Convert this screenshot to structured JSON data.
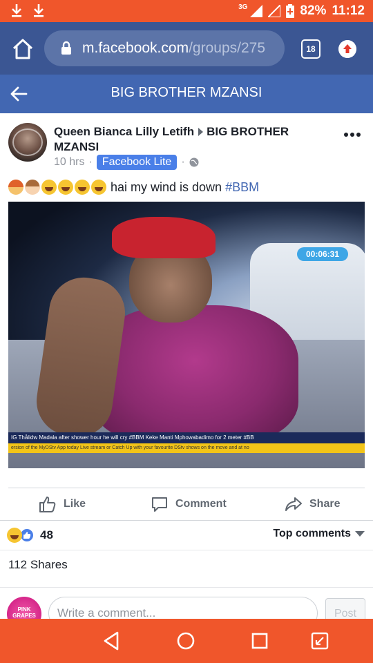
{
  "status_bar": {
    "network": "3G",
    "battery": "82%",
    "time": "11:12"
  },
  "browser": {
    "url_host": "m.facebook.com",
    "url_path": "/groups/275",
    "tab_count": "18"
  },
  "group": {
    "title": "BIG BROTHER MZANSI"
  },
  "post": {
    "author": "Queen Bianca Lilly Letifh",
    "group_name": "BIG BROTHER MZANSI",
    "time": "10 hrs",
    "app_badge": "Facebook Lite",
    "text": "hai my wind is down",
    "hashtag": "#BBM",
    "photo": {
      "timer": "00:06:31",
      "ticker_top": "IG Thålidw  Madala after shower hour he will cry #BBM   Keke Manti  Mphowabadimo for 2 meter #BB",
      "ticker_bottom": "ersion of the MyDStv App today   Live stream or Catch Up with your favourite DStv shows on the move and at no"
    }
  },
  "actions": {
    "like": "Like",
    "comment": "Comment",
    "share": "Share"
  },
  "reactions": {
    "count": "48",
    "top_comments": "Top comments"
  },
  "shares": {
    "label": "112 Shares"
  },
  "comment_box": {
    "placeholder": "Write a comment...",
    "post_label": "Post",
    "avatar_text": "PINK GRAPES"
  },
  "colors": {
    "status_bar": "#f0562b",
    "browser_bar": "#3b5693",
    "group_header": "#4267b2",
    "fb_lite_badge": "#4a7fe8"
  }
}
